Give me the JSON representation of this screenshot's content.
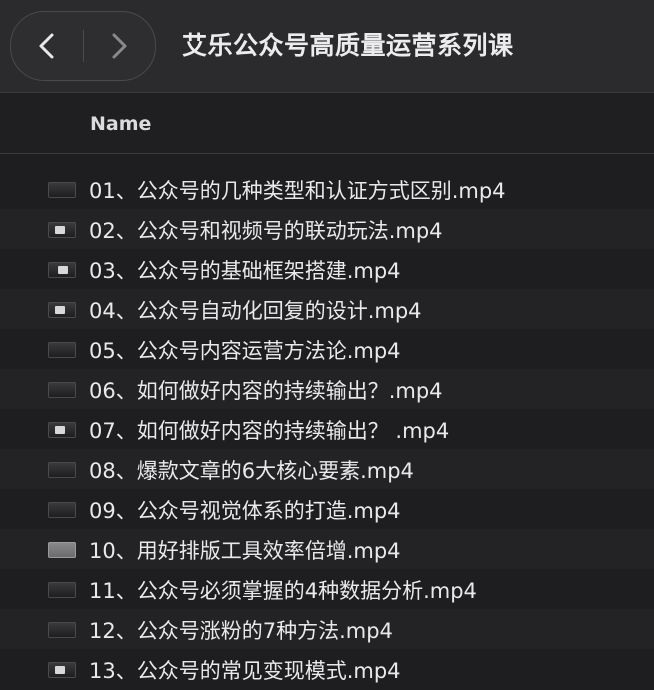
{
  "window": {
    "title": "艾乐公众号高质量运营系列课"
  },
  "nav": {
    "back_icon": "chevron-left-icon",
    "forward_icon": "chevron-right-icon"
  },
  "columns": {
    "name_header": "Name"
  },
  "files": [
    {
      "name": "01、公众号的几种类型和认证方式区别.mp4",
      "thumb": "dark"
    },
    {
      "name": "02、公众号和视频号的联动玩法.mp4",
      "thumb": "spot-left"
    },
    {
      "name": "03、公众号的基础框架搭建.mp4",
      "thumb": "spot-mid"
    },
    {
      "name": "04、公众号自动化回复的设计.mp4",
      "thumb": "spot-left"
    },
    {
      "name": "05、公众号内容运营方法论.mp4",
      "thumb": "dark"
    },
    {
      "name": "06、如何做好内容的持续输出？.mp4",
      "thumb": "dark"
    },
    {
      "name": "07、如何做好内容的持续输出？ .mp4",
      "thumb": "spot-left"
    },
    {
      "name": "08、爆款文章的6大核心要素.mp4",
      "thumb": "dark"
    },
    {
      "name": "09、公众号视觉体系的打造.mp4",
      "thumb": "dark"
    },
    {
      "name": "10、用好排版工具效率倍增.mp4",
      "thumb": "light"
    },
    {
      "name": "11、公众号必须掌握的4种数据分析.mp4",
      "thumb": "dark"
    },
    {
      "name": "12、公众号涨粉的7种方法.mp4",
      "thumb": "dark"
    },
    {
      "name": "13、公众号的常见变现模式.mp4",
      "thumb": "spot-left"
    }
  ]
}
